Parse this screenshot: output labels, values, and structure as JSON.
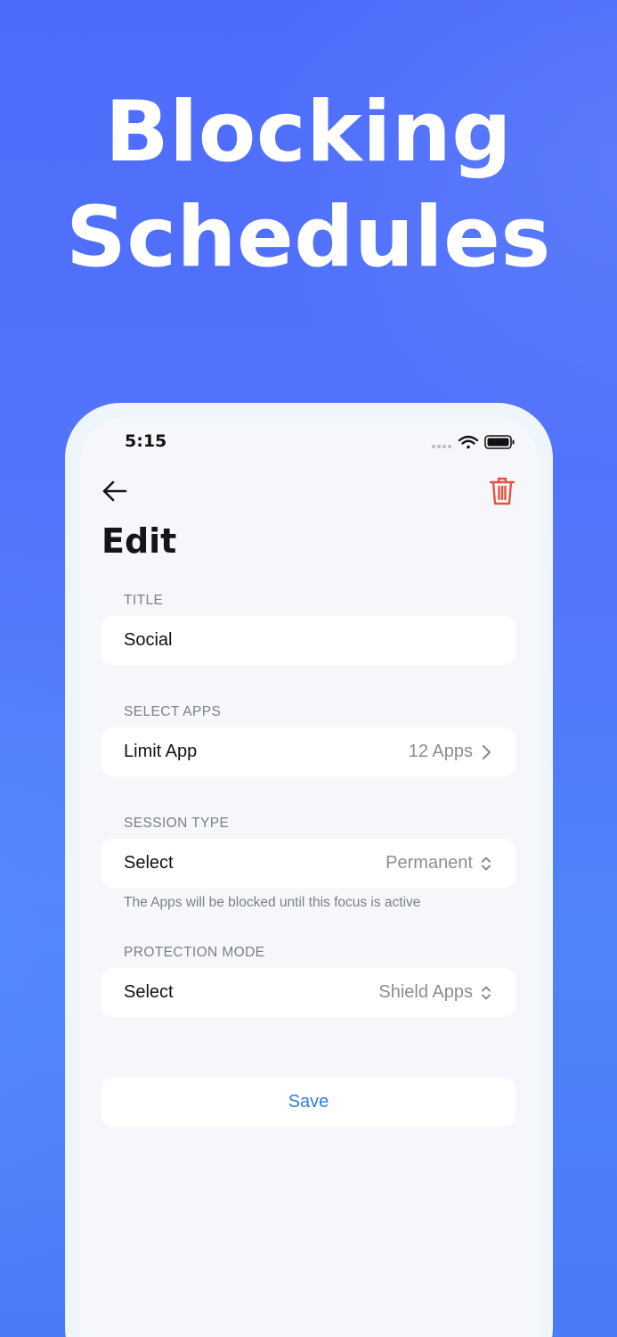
{
  "headline": {
    "line1": "Blocking",
    "line2": "Schedules"
  },
  "status_bar": {
    "time": "5:15",
    "icons": [
      "signal-dots-icon",
      "wifi-icon",
      "battery-icon"
    ]
  },
  "nav": {
    "back_icon": "arrow-left-icon",
    "delete_icon": "trash-icon",
    "title": "Edit"
  },
  "form": {
    "title_section": {
      "label": "TITLE",
      "value": "Social"
    },
    "apps_section": {
      "label": "SELECT APPS",
      "row_label": "Limit App",
      "row_value": "12 Apps"
    },
    "session_section": {
      "label": "SESSION TYPE",
      "row_label": "Select",
      "row_value": "Permanent",
      "note": "The Apps will be blocked until this focus is active"
    },
    "protection_section": {
      "label": "PROTECTION MODE",
      "row_label": "Select",
      "row_value": "Shield Apps"
    },
    "save_label": "Save"
  },
  "colors": {
    "background": "#4e6ffb",
    "accent_blue": "#2f7fe3",
    "delete_red": "#e8503f",
    "card_bg": "#ffffff",
    "screen_bg": "#f5f7fb"
  }
}
